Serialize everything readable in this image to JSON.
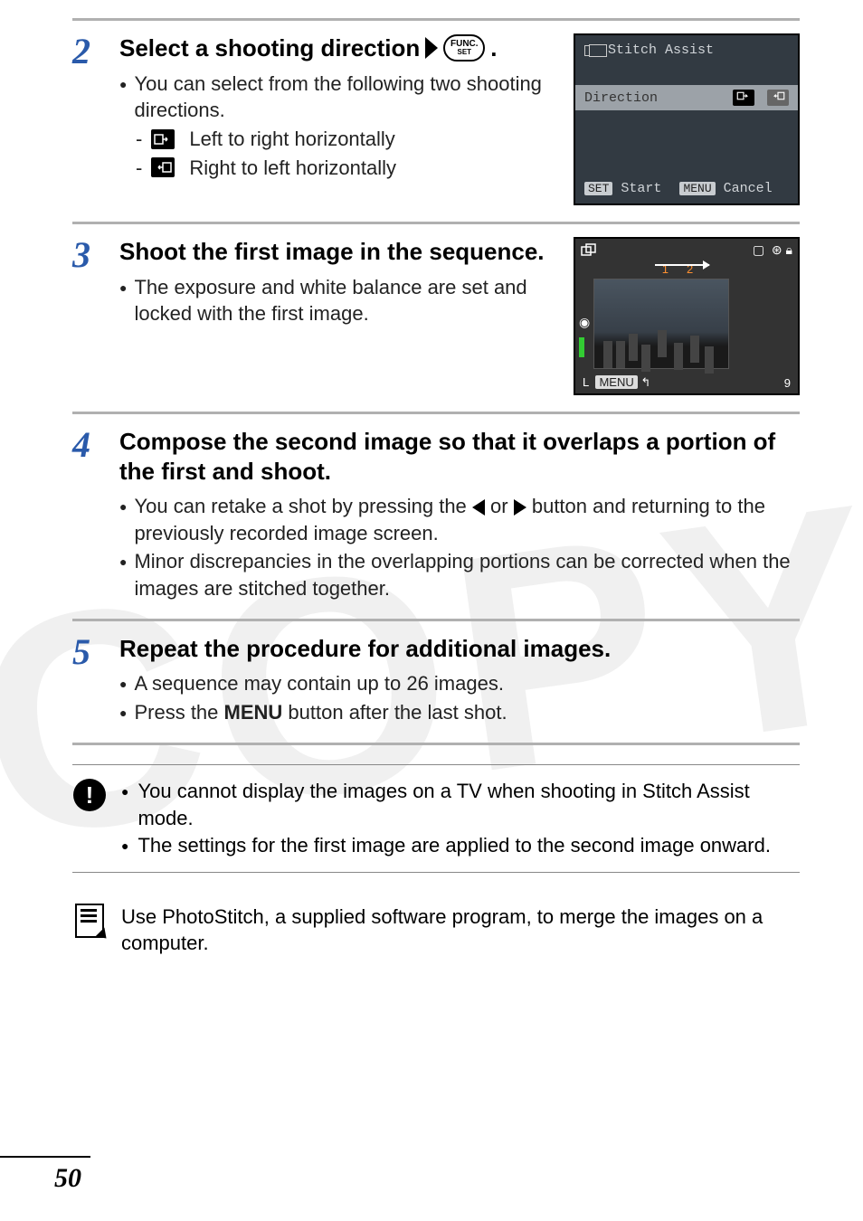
{
  "watermark": "COPY",
  "page_number": "50",
  "steps": {
    "s2": {
      "num": "2",
      "title_a": "Select a shooting direction",
      "func_top": "FUNC.",
      "func_bot": "SET",
      "title_dot": ".",
      "bullet1": "You can select from the following two shooting directions.",
      "sub1": "Left to right horizontally",
      "sub2": "Right to left horizontally",
      "lcd": {
        "title": "Stitch Assist",
        "row_label": "Direction",
        "set": "SET",
        "start": "Start",
        "menu": "MENU",
        "cancel": "Cancel"
      }
    },
    "s3": {
      "num": "3",
      "title": "Shoot the first image in the sequence.",
      "bullet1": "The exposure and white balance are set and locked with the first image.",
      "lcd": {
        "seq1": "1",
        "seq2": "2",
        "menu": "MENU",
        "L": "L",
        "nine": "9"
      }
    },
    "s4": {
      "num": "4",
      "title": "Compose the second image so that it overlaps a portion of the first and shoot.",
      "bullet1_a": "You can retake a shot by pressing the ",
      "bullet1_b": " or ",
      "bullet1_c": " button and returning to the previously recorded image screen.",
      "bullet2": "Minor discrepancies in the overlapping portions can be corrected when the images are stitched together."
    },
    "s5": {
      "num": "5",
      "title": "Repeat the procedure for additional images.",
      "bullet1": "A sequence may contain up to 26 images.",
      "bullet2_a": "Press the ",
      "bullet2_b": "MENU",
      "bullet2_c": " button after the last shot."
    }
  },
  "notes": {
    "warn1": "You cannot display the images on a TV when shooting in Stitch Assist mode.",
    "warn2": "The settings for the first image are applied to the second image onward.",
    "info": "Use PhotoStitch, a supplied software program, to merge the images on a computer."
  }
}
